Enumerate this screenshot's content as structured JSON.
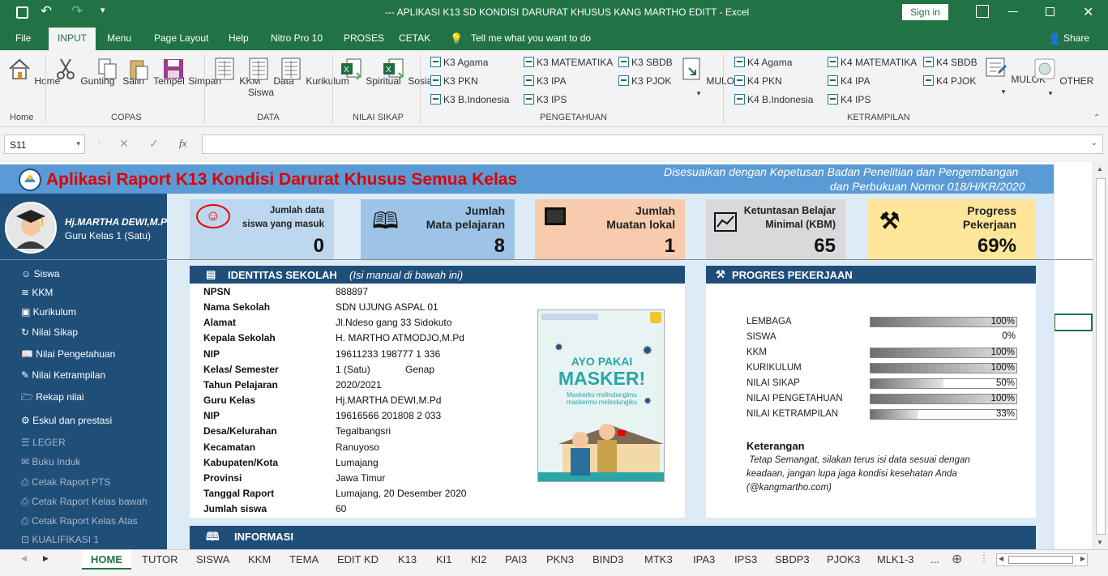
{
  "titlebar": {
    "title": "--- APLIKASI K13 SD KONDISI DARURAT KHUSUS KANG MARTHO EDITT  -  Excel",
    "signin": "Sign in"
  },
  "menu": {
    "file": "File",
    "input": "INPUT",
    "menu": "Menu",
    "page_layout": "Page Layout",
    "help": "Help",
    "nitro": "Nitro Pro 10",
    "proses": "PROSES",
    "cetak": "CETAK",
    "tell": "Tell me what you want to do",
    "share": "Share"
  },
  "ribbon": {
    "home": "Home",
    "home_group": "Home",
    "gunting": "Gunting",
    "salin": "Salin",
    "tempel": "Tempel",
    "simpan": "Simpan",
    "copas_group": "COPAS",
    "kkm": "KKM",
    "data_siswa_1": "Data",
    "data_siswa_2": "Siswa",
    "kurikulum": "Kurikulum",
    "data_group": "DATA",
    "spiritual": "Spiritual",
    "sosial": "Sosial",
    "sikap_group": "NILAI SIKAP",
    "k3_col1": [
      "K3 Agama",
      "K3 PKN",
      "K3 B.Indonesia"
    ],
    "k3_col2": [
      "K3 MATEMATIKA",
      "K3 IPA",
      "K3 IPS"
    ],
    "k3_col3": [
      "K3 SBDB",
      "K3 PJOK"
    ],
    "mulok": "MULOK",
    "pengetahuan_group": "PENGETAHUAN",
    "k4_col1": [
      "K4 Agama",
      "K4 PKN",
      "K4 B.Indonesia"
    ],
    "k4_col2": [
      "K4 MATEMATIKA",
      "K4 IPA",
      "K4 IPS"
    ],
    "k4_col3": [
      "K4 SBDB",
      "K4 PJOK"
    ],
    "mulok2": "MULOK",
    "other": "OTHER",
    "ketrampilan_group": "KETRAMPILAN"
  },
  "formula": {
    "namebox": "S11",
    "fx": "fx"
  },
  "app": {
    "title": "Aplikasi Raport  K13 Kondisi Darurat Khusus Semua Kelas",
    "subtitle1": "Disesuaikan dengan Kepetusan Badan Penelitian dan Pengembangan",
    "subtitle2": "dan Perbukuan Nomor 018/H/KR/2020",
    "user_name": "Hj.MARTHA DEWI,M.Pd",
    "user_role": "Guru Kelas 1 (Satu)"
  },
  "sidebar": [
    {
      "label": "Siswa",
      "dim": false
    },
    {
      "label": "KKM",
      "dim": false
    },
    {
      "label": "Kurikulum",
      "dim": false
    },
    {
      "label": "Nilai Sikap",
      "dim": false
    },
    {
      "label": "Nilai Pengetahuan",
      "dim": false
    },
    {
      "label": "Nilai Ketrampilan",
      "dim": false
    },
    {
      "label": "Rekap nilai",
      "dim": false
    },
    {
      "label": "Eskul dan prestasi",
      "dim": false
    },
    {
      "label": "LEGER",
      "dim": true
    },
    {
      "label": "Buku Induk",
      "dim": true
    },
    {
      "label": "Cetak Raport PTS",
      "dim": true
    },
    {
      "label": "Cetak Raport Kelas bawah",
      "dim": true
    },
    {
      "label": "Cetak Raport Kelas Atas",
      "dim": true
    },
    {
      "label": "KUALIFIKASI 1",
      "dim": true
    }
  ],
  "cards": [
    {
      "t1": "Jumlah data",
      "t2": "siswa yang masuk",
      "value": "0",
      "bg": "#bdd7ee"
    },
    {
      "t1": "Jumlah",
      "t2": "Mata pelajaran",
      "value": "8",
      "bg": "#9dc3e6"
    },
    {
      "t1": "Jumlah",
      "t2": "Muatan lokal",
      "value": "1",
      "bg": "#f8cbad"
    },
    {
      "t1": "Ketuntasan Belajar",
      "t2": "Minimal (KBM)",
      "value": "65",
      "bg": "#d9d9d9"
    },
    {
      "t1": "Progress",
      "t2": "Pekerjaan",
      "value": "69%",
      "bg": "#ffe699"
    }
  ],
  "identitas": {
    "header": "IDENTITAS SEKOLAH",
    "header_note": "(Isi manual di bawah ini)",
    "rows": [
      {
        "label": "NPSN",
        "value": "888897"
      },
      {
        "label": "Nama Sekolah",
        "value": "SDN UJUNG ASPAL 01"
      },
      {
        "label": "Alamat",
        "value": "Jl.Ndeso gang 33 Sidokuto"
      },
      {
        "label": "Kepala Sekolah",
        "value": "H. MARTHO ATMODJO,M.Pd"
      },
      {
        "label": "NIP",
        "value": "19611233 198777 1 336"
      },
      {
        "label": "Kelas/ Semester",
        "value": "1 (Satu)"
      },
      {
        "label": "Tahun Pelajaran",
        "value": "2020/2021"
      },
      {
        "label": "Guru Kelas",
        "value": "Hj.MARTHA DEWI,M.Pd"
      },
      {
        "label": "NIP",
        "value": "19616566 201808 2 033"
      },
      {
        "label": "Desa/Kelurahan",
        "value": "Tegalbangsri"
      },
      {
        "label": "Kecamatan",
        "value": "Ranuyoso"
      },
      {
        "label": "Kabupaten/Kota",
        "value": "Lumajang"
      },
      {
        "label": "Provinsi",
        "value": "Jawa Timur"
      },
      {
        "label": "Tanggal Raport",
        "value": "Lumajang, 20 Desember 2020"
      },
      {
        "label": "Jumlah siswa",
        "value": "60"
      }
    ],
    "semester": "Genap",
    "poster_line1": "AYO PAKAI",
    "poster_line2": "MASKER!",
    "poster_sub1": "Maskerku melindungimu",
    "poster_sub2": "maskermu melindungiku"
  },
  "progres": {
    "header": "PROGRES PEKERJAAN",
    "rows": [
      {
        "label": "LEMBAGA",
        "value": "100%",
        "pct": 100
      },
      {
        "label": "SISWA",
        "value": "0%",
        "pct": 0
      },
      {
        "label": "KKM",
        "value": "100%",
        "pct": 100
      },
      {
        "label": "KURIKULUM",
        "value": "100%",
        "pct": 100
      },
      {
        "label": "NILAI SIKAP",
        "value": "50%",
        "pct": 50
      },
      {
        "label": "NILAI PENGETAHUAN",
        "value": "100%",
        "pct": 100
      },
      {
        "label": "NILAI KETRAMPILAN",
        "value": "33%",
        "pct": 33
      }
    ],
    "keterangan_title": "Keterangan",
    "keterangan_1": " Tetap Semangat, silakan terus isi data sesuai dengan",
    "keterangan_2": "keadaan, jangan lupa jaga kondisi kesehatan Anda",
    "keterangan_3": "(@kangmartho.com)"
  },
  "informasi": {
    "header": "INFORMASI"
  },
  "sheet_tabs": [
    "HOME",
    "TUTOR",
    "SISWA",
    "KKM",
    "TEMA",
    "EDIT KD",
    "K13",
    "KI1",
    "KI2",
    "PAI3",
    "PKN3",
    "BIND3",
    "MTK3",
    "IPA3",
    "IPS3",
    "SBDP3",
    "PJOK3",
    "MLK1-3",
    "..."
  ]
}
